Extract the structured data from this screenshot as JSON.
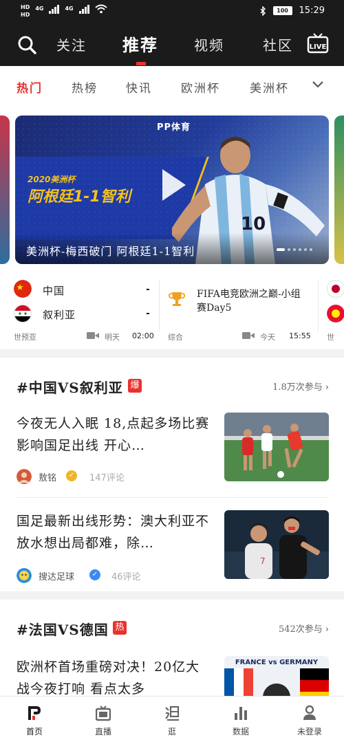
{
  "status_bar": {
    "sim1": "HD",
    "sim2": "HD",
    "net1": "4G",
    "net2": "4G",
    "battery": "100",
    "time": "15:29"
  },
  "top_nav": {
    "tabs": [
      "关注",
      "推荐",
      "视频",
      "社区"
    ],
    "active_tab": "推荐",
    "live_label": "LIVE"
  },
  "categories": {
    "items": [
      "热门",
      "热榜",
      "快讯",
      "欧洲杯",
      "美洲杯"
    ],
    "active": "热门"
  },
  "carousel": {
    "logo": "PP体育",
    "year_tag": "2020美洲杯",
    "headline": "阿根廷1-1智利",
    "caption": "美洲杯-梅西破门 阿根廷1-1智利",
    "jersey_number": "10"
  },
  "matches": [
    {
      "home": "中国",
      "away": "叙利亚",
      "home_score": "-",
      "away_score": "-",
      "league": "世预亚",
      "day": "明天",
      "time": "02:00"
    },
    {
      "title": "FIFA电竞欧洲之巅-小组赛Day5",
      "league": "综合",
      "day": "今天",
      "time": "15:55"
    },
    {
      "league": "世"
    }
  ],
  "topics": [
    {
      "title": "#中国VS叙利亚",
      "badge": "爆",
      "participants": "1.8万次参与",
      "articles": [
        {
          "title": "今夜无人入眠 18,点起多场比赛影响国足出线 开心…",
          "author": "敖铭",
          "comments": "147评论"
        },
        {
          "title": "国足最新出线形势：澳大利亚不放水想出局都难，除…",
          "author": "搜达足球",
          "comments": "46评论"
        }
      ]
    },
    {
      "title": "#法国VS德国",
      "badge": "热",
      "participants": "542次参与",
      "articles": [
        {
          "title": "欧洲杯首场重磅对决！20亿大战今夜打响 看点太多",
          "thumb_text": "FRANCE vs GERMANY"
        }
      ]
    }
  ],
  "bottom_tabs": [
    "首页",
    "直播",
    "逛",
    "数据",
    "未登录"
  ],
  "colors": {
    "accent": "#e8322e",
    "header_bg": "#1b1b1b",
    "gold": "#f5c11c",
    "verify_gold": "#f0b429",
    "verify_blue": "#3b8cf0"
  }
}
